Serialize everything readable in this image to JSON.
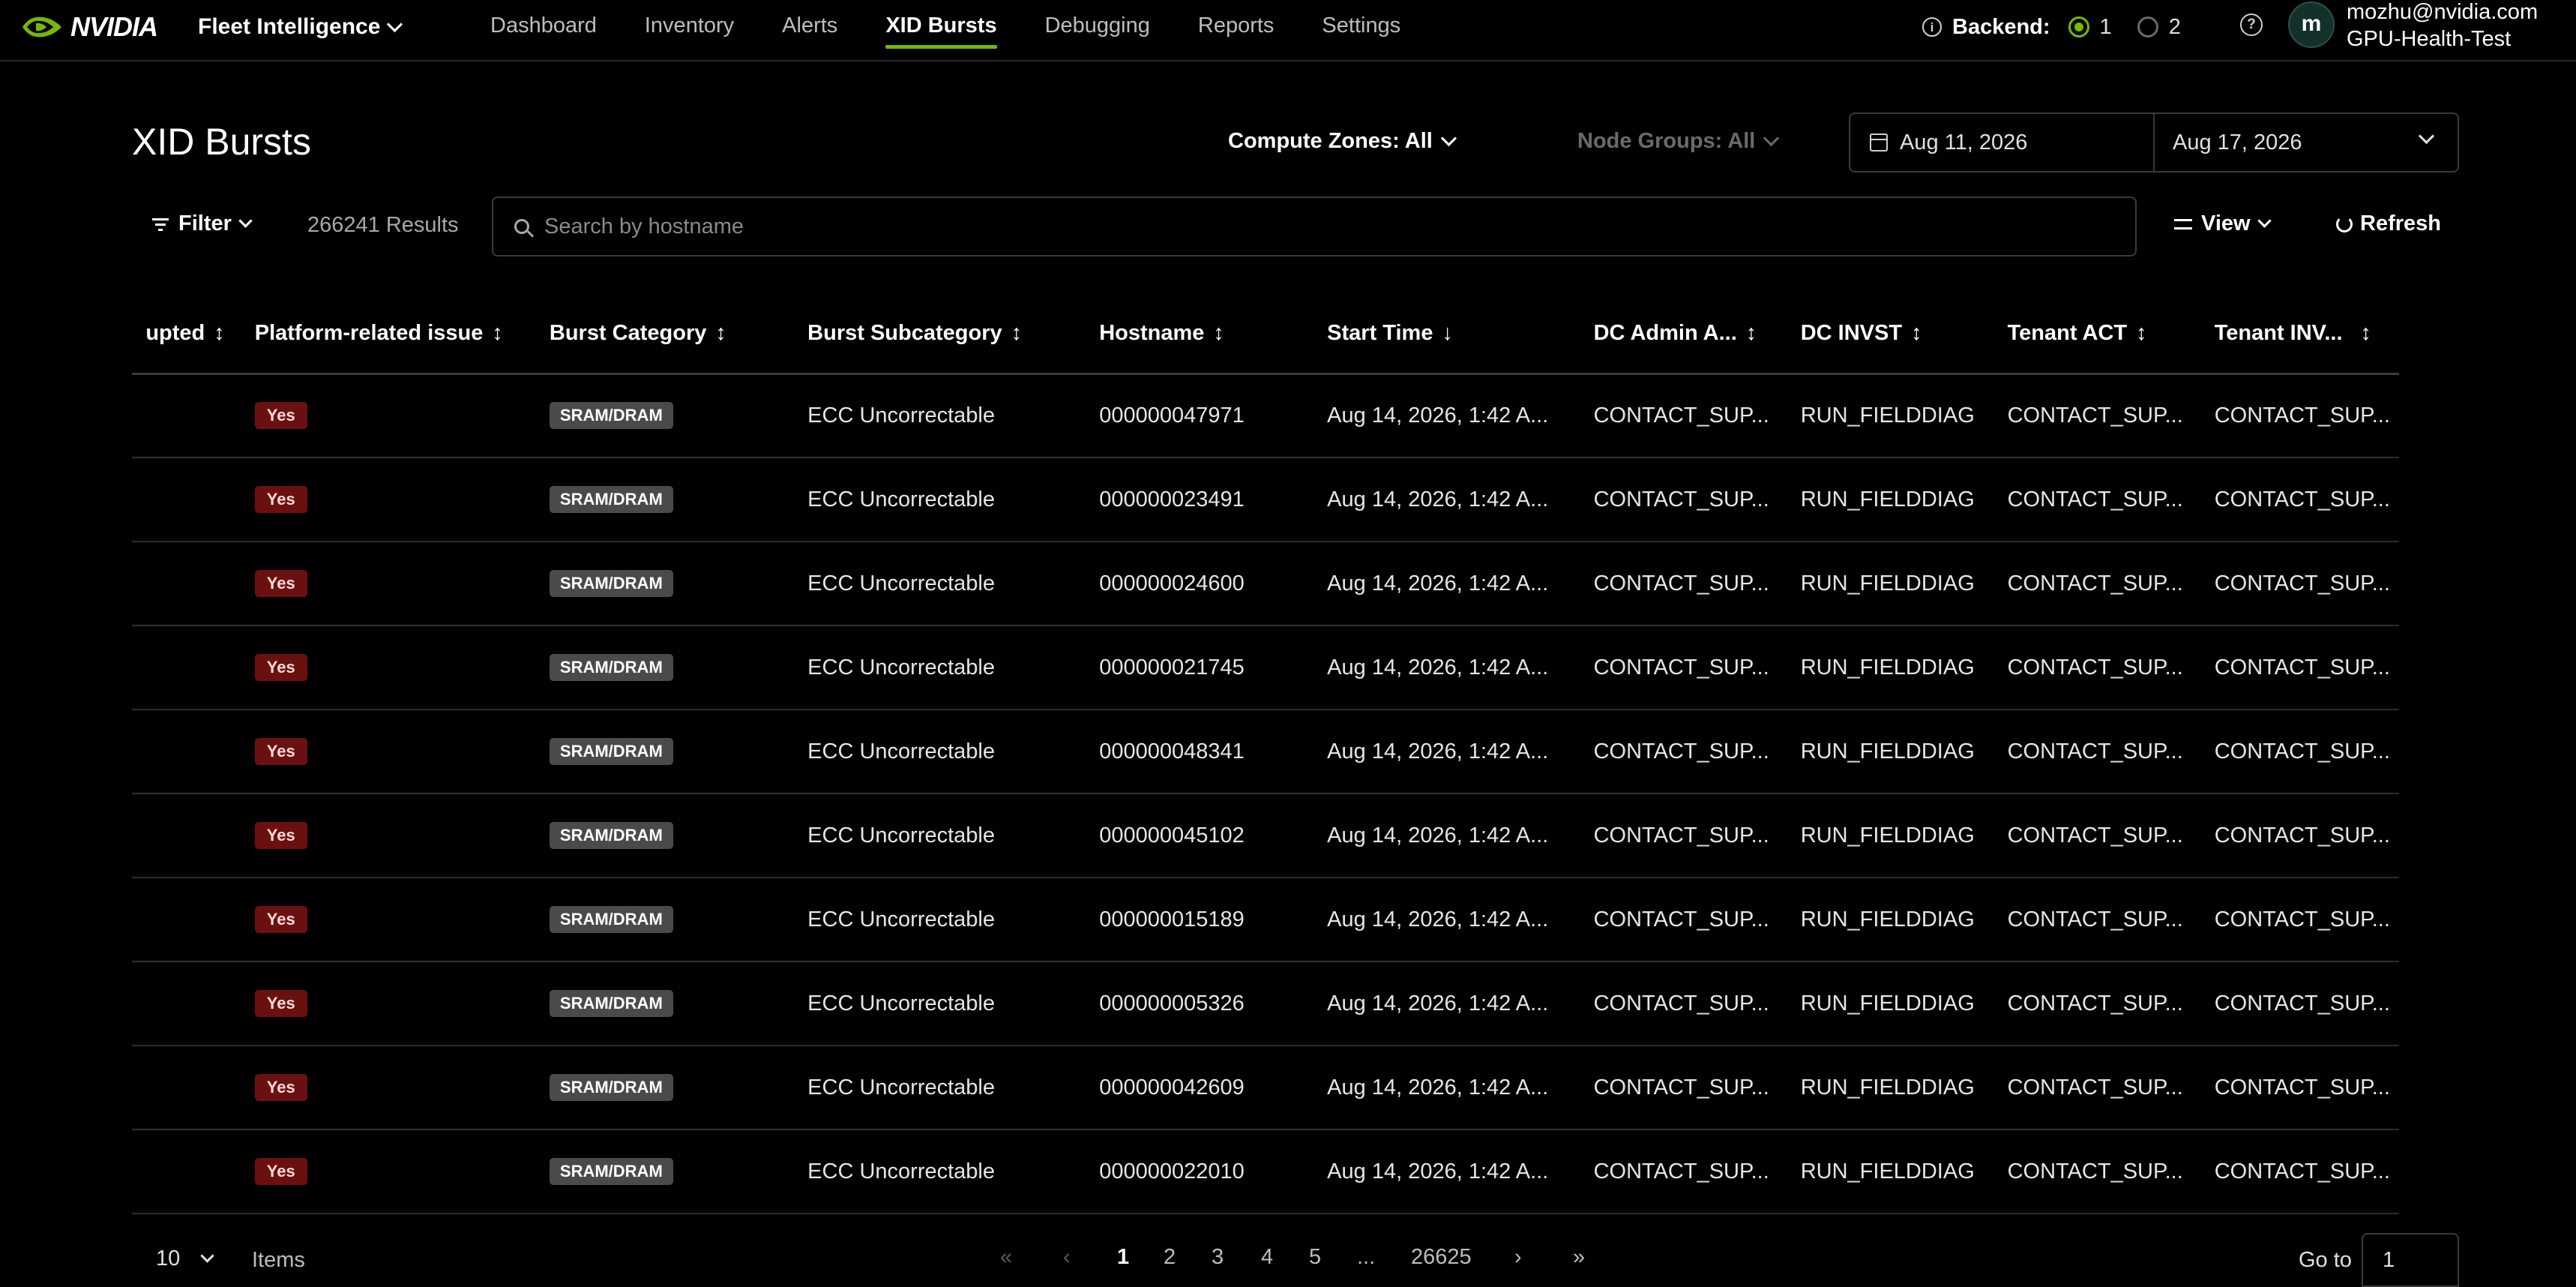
{
  "brand": {
    "logo_text": "NVIDIA",
    "accent": "#76b900"
  },
  "app_switcher": {
    "label": "Fleet Intelligence"
  },
  "nav": {
    "tabs": [
      {
        "label": "Dashboard"
      },
      {
        "label": "Inventory"
      },
      {
        "label": "Alerts"
      },
      {
        "label": "XID Bursts"
      },
      {
        "label": "Debugging"
      },
      {
        "label": "Reports"
      },
      {
        "label": "Settings"
      }
    ],
    "active_tab": "XID Bursts"
  },
  "backend": {
    "label": "Backend:",
    "options": [
      "1",
      "2"
    ],
    "selected": "1"
  },
  "user": {
    "avatar_initial": "m",
    "email": "mozhu@nvidia.com",
    "org": "GPU-Health-Test"
  },
  "page": {
    "title": "XID Bursts",
    "compute_zones": "Compute Zones: All",
    "node_groups": "Node Groups: All",
    "date_start": "Aug 11, 2026",
    "date_end": "Aug 17, 2026"
  },
  "toolbar": {
    "filter_label": "Filter",
    "results": "266241 Results",
    "search_placeholder": "Search by hostname",
    "search_value": "",
    "view_label": "View",
    "refresh_label": "Refresh"
  },
  "table": {
    "columns": [
      "upted",
      "Platform-related issue",
      "Burst Category",
      "Burst Subcategory",
      "Hostname",
      "Start Time",
      "DC Admin A...",
      "DC INVST",
      "Tenant ACT",
      "Tenant INV..."
    ],
    "rows": [
      {
        "platform": "Yes",
        "category": "SRAM/DRAM",
        "subcategory": "ECC Uncorrectable",
        "hostname": "000000047971",
        "start": "Aug 14, 2026, 1:42 A...",
        "dc_admin": "CONTACT_SUP...",
        "dc_invst": "RUN_FIELDDIAG",
        "tenant_act": "CONTACT_SUP...",
        "tenant_inv": "CONTACT_SUP..."
      },
      {
        "platform": "Yes",
        "category": "SRAM/DRAM",
        "subcategory": "ECC Uncorrectable",
        "hostname": "000000023491",
        "start": "Aug 14, 2026, 1:42 A...",
        "dc_admin": "CONTACT_SUP...",
        "dc_invst": "RUN_FIELDDIAG",
        "tenant_act": "CONTACT_SUP...",
        "tenant_inv": "CONTACT_SUP..."
      },
      {
        "platform": "Yes",
        "category": "SRAM/DRAM",
        "subcategory": "ECC Uncorrectable",
        "hostname": "000000024600",
        "start": "Aug 14, 2026, 1:42 A...",
        "dc_admin": "CONTACT_SUP...",
        "dc_invst": "RUN_FIELDDIAG",
        "tenant_act": "CONTACT_SUP...",
        "tenant_inv": "CONTACT_SUP..."
      },
      {
        "platform": "Yes",
        "category": "SRAM/DRAM",
        "subcategory": "ECC Uncorrectable",
        "hostname": "000000021745",
        "start": "Aug 14, 2026, 1:42 A...",
        "dc_admin": "CONTACT_SUP...",
        "dc_invst": "RUN_FIELDDIAG",
        "tenant_act": "CONTACT_SUP...",
        "tenant_inv": "CONTACT_SUP..."
      },
      {
        "platform": "Yes",
        "category": "SRAM/DRAM",
        "subcategory": "ECC Uncorrectable",
        "hostname": "000000048341",
        "start": "Aug 14, 2026, 1:42 A...",
        "dc_admin": "CONTACT_SUP...",
        "dc_invst": "RUN_FIELDDIAG",
        "tenant_act": "CONTACT_SUP...",
        "tenant_inv": "CONTACT_SUP..."
      },
      {
        "platform": "Yes",
        "category": "SRAM/DRAM",
        "subcategory": "ECC Uncorrectable",
        "hostname": "000000045102",
        "start": "Aug 14, 2026, 1:42 A...",
        "dc_admin": "CONTACT_SUP...",
        "dc_invst": "RUN_FIELDDIAG",
        "tenant_act": "CONTACT_SUP...",
        "tenant_inv": "CONTACT_SUP..."
      },
      {
        "platform": "Yes",
        "category": "SRAM/DRAM",
        "subcategory": "ECC Uncorrectable",
        "hostname": "000000015189",
        "start": "Aug 14, 2026, 1:42 A...",
        "dc_admin": "CONTACT_SUP...",
        "dc_invst": "RUN_FIELDDIAG",
        "tenant_act": "CONTACT_SUP...",
        "tenant_inv": "CONTACT_SUP..."
      },
      {
        "platform": "Yes",
        "category": "SRAM/DRAM",
        "subcategory": "ECC Uncorrectable",
        "hostname": "000000005326",
        "start": "Aug 14, 2026, 1:42 A...",
        "dc_admin": "CONTACT_SUP...",
        "dc_invst": "RUN_FIELDDIAG",
        "tenant_act": "CONTACT_SUP...",
        "tenant_inv": "CONTACT_SUP..."
      },
      {
        "platform": "Yes",
        "category": "SRAM/DRAM",
        "subcategory": "ECC Uncorrectable",
        "hostname": "000000042609",
        "start": "Aug 14, 2026, 1:42 A...",
        "dc_admin": "CONTACT_SUP...",
        "dc_invst": "RUN_FIELDDIAG",
        "tenant_act": "CONTACT_SUP...",
        "tenant_inv": "CONTACT_SUP..."
      },
      {
        "platform": "Yes",
        "category": "SRAM/DRAM",
        "subcategory": "ECC Uncorrectable",
        "hostname": "000000022010",
        "start": "Aug 14, 2026, 1:42 A...",
        "dc_admin": "CONTACT_SUP...",
        "dc_invst": "RUN_FIELDDIAG",
        "tenant_act": "CONTACT_SUP...",
        "tenant_inv": "CONTACT_SUP..."
      }
    ]
  },
  "pagination": {
    "page_size": "10",
    "items_label": "Items",
    "pages": [
      "1",
      "2",
      "3",
      "4",
      "5",
      "...",
      "26625"
    ],
    "current": "1",
    "goto_label": "Go to",
    "goto_value": "1"
  }
}
